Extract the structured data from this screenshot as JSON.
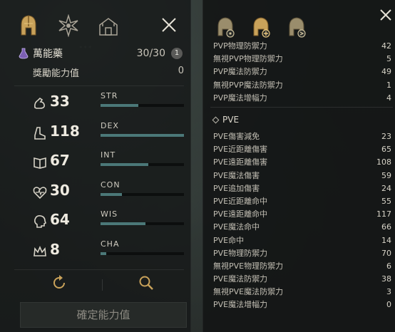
{
  "left": {
    "tabs": [
      {
        "icon": "helmet-icon"
      },
      {
        "icon": "star-burst-icon"
      },
      {
        "icon": "castle-icon"
      }
    ],
    "elixir": {
      "name": "萬能藥",
      "count": "30/30",
      "badge": "1"
    },
    "bonus": {
      "label": "獎勵能力值",
      "value": "0"
    },
    "stats": [
      {
        "name": "STR",
        "value": "33",
        "icon": "strength-arm-icon",
        "fill": 0.45
      },
      {
        "name": "DEX",
        "value": "118",
        "icon": "dexterity-boot-icon",
        "fill": 1.0
      },
      {
        "name": "INT",
        "value": "67",
        "icon": "intelligence-book-icon",
        "fill": 0.57
      },
      {
        "name": "CON",
        "value": "30",
        "icon": "constitution-heart-icon",
        "fill": 0.26
      },
      {
        "name": "WIS",
        "value": "64",
        "icon": "wisdom-head-icon",
        "fill": 0.54
      },
      {
        "name": "CHA",
        "value": "8",
        "icon": "charisma-crown-icon",
        "fill": 0.07
      }
    ],
    "confirm_label": "確定能力值"
  },
  "right": {
    "top_list": [
      {
        "label": "PVP物理防禦力",
        "value": "42"
      },
      {
        "label": "無視PVP物理防禦力",
        "value": "5"
      },
      {
        "label": "PVP魔法防禦力",
        "value": "49"
      },
      {
        "label": "無視PVP魔法防禦力",
        "value": "1"
      },
      {
        "label": "PVP魔法增幅力",
        "value": "4"
      }
    ],
    "pve_header": "PVE",
    "pve_list": [
      {
        "label": "PVE傷害減免",
        "value": "23"
      },
      {
        "label": "PVE近距離傷害",
        "value": "65"
      },
      {
        "label": "PVE遠距離傷害",
        "value": "108"
      },
      {
        "label": "PVE魔法傷害",
        "value": "59"
      },
      {
        "label": "PVE追加傷害",
        "value": "24"
      },
      {
        "label": "PVE近距離命中",
        "value": "55"
      },
      {
        "label": "PVE遠距離命中",
        "value": "117"
      },
      {
        "label": "PVE魔法命中",
        "value": "66"
      },
      {
        "label": "PVE命中",
        "value": "14"
      },
      {
        "label": "PVE物理防禦力",
        "value": "70"
      },
      {
        "label": "無視PVE物理防禦力",
        "value": "6"
      },
      {
        "label": "PVE魔法防禦力",
        "value": "38"
      },
      {
        "label": "無視PVE魔法防禦力",
        "value": "3"
      },
      {
        "label": "PVE魔法增幅力",
        "value": "0"
      }
    ]
  },
  "colors": {
    "bar_fill": "#4b7878",
    "bar_bg": "#0c0e0e",
    "gold": "#c9a25a"
  }
}
